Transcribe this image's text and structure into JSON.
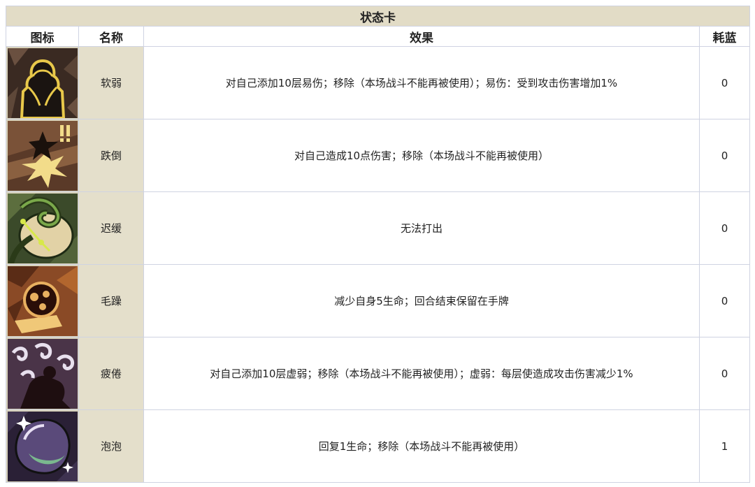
{
  "table_title": "状态卡",
  "headers": {
    "icon": "图标",
    "name": "名称",
    "effect": "效果",
    "cost": "耗蓝"
  },
  "rows": [
    {
      "icon": "weak-icon",
      "name": "软弱",
      "effect": "对自己添加10层易伤；移除（本场战斗不能再被使用）；易伤：受到攻击伤害增加1%",
      "cost": "0"
    },
    {
      "icon": "stumble-icon",
      "name": "跌倒",
      "effect": "对自己造成10点伤害；移除（本场战斗不能再被使用）",
      "cost": "0"
    },
    {
      "icon": "slow-icon",
      "name": "迟缓",
      "effect": "无法打出",
      "cost": "0"
    },
    {
      "icon": "irritable-icon",
      "name": "毛躁",
      "effect": "减少自身5生命；回合结束保留在手牌",
      "cost": "0"
    },
    {
      "icon": "fatigue-icon",
      "name": "疲倦",
      "effect": "对自己添加10层虚弱；移除（本场战斗不能再被使用）；虚弱：每层使造成攻击伤害减少1%",
      "cost": "0"
    },
    {
      "icon": "bubble-icon",
      "name": "泡泡",
      "effect": "回复1生命；移除（本场战斗不能再被使用）",
      "cost": "1"
    }
  ]
}
